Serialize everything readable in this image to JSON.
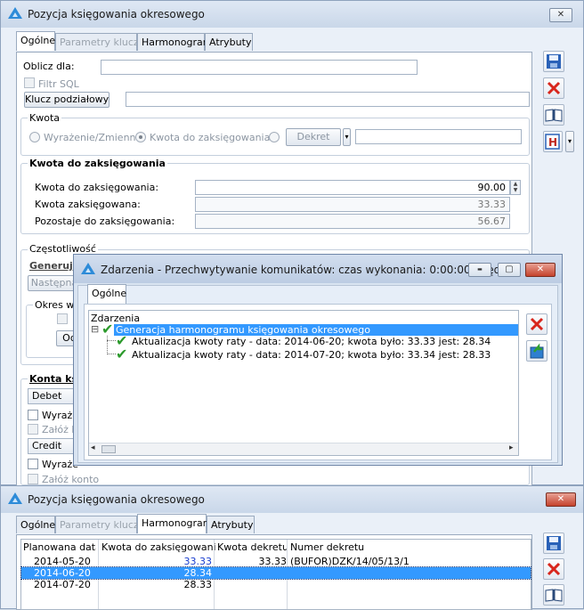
{
  "main_window": {
    "title": "Pozycja księgowania okresowego",
    "close_label": "✕",
    "tabs": [
      {
        "label": "Ogólne",
        "state": "active"
      },
      {
        "label": "Parametry klucza",
        "state": "disabled"
      },
      {
        "label": "Harmonogram",
        "state": "normal"
      },
      {
        "label": "Atrybuty",
        "state": "normal"
      }
    ],
    "oblicz_dla_label": "Oblicz dla:",
    "oblicz_dla_value": "",
    "filtr_sql_label": "Filtr SQL",
    "klucz_button": "Klucz podziałowy",
    "klucz_value": "",
    "kwota_group": {
      "title": "Kwota",
      "radio_wyrazenie": "Wyrażenie/Zmienna",
      "radio_kwota": "Kwota do zaksięgowania",
      "dekret_button": "Dekret",
      "dekret_dropdown": "▾",
      "dekret_value": ""
    },
    "kwota_zaks_group": {
      "title": "Kwota do zaksięgowania",
      "rows": [
        {
          "label": "Kwota do zaksięgowania:",
          "value": "90.00"
        },
        {
          "label": "Kwota zaksięgowana:",
          "value": "33.33"
        },
        {
          "label": "Pozostaje do zaksięgowania:",
          "value": "56.67"
        }
      ]
    },
    "czestotliwosc_group": {
      "title": "Częstotliwość",
      "generuj_label": "Generuj c",
      "nastepna_button": "Następna",
      "okres_label": "Okres wa",
      "od_button": "Od"
    },
    "konta_group": {
      "title": "Konta ksi",
      "debet_select": "Debet",
      "debet_wyraz": "Wyraże",
      "debet_zaloz": "Załóż ko",
      "credit_select": "Credit",
      "credit_wyraz": "Wyraże",
      "credit_zaloz": "Załóż konto"
    },
    "side_menu_arrow": "▾"
  },
  "dialog": {
    "title": "Zdarzenia - Przechwytywanie komunikatów: czas wykonania: 0:00:00, błędó...",
    "minimize": "▬",
    "maximize": "▢",
    "close": "✕",
    "tab": "Ogólne",
    "tree_header": "Zdarzenia",
    "root_label": "Generacja harmonogramu księgowania okresowego",
    "expander": "⊟",
    "children": [
      "Aktualizacja kwoty raty - data: 2014-06-20; kwota było: 33.33 jest: 28.34",
      "Aktualizacja kwoty raty - data: 2014-07-20; kwota było: 33.34 jest: 28.33"
    ],
    "scroll_left": "◂",
    "scroll_right": "▸"
  },
  "bottom_window": {
    "title": "Pozycja księgowania okresowego",
    "close_label": "✕",
    "tabs": [
      {
        "label": "Ogólne",
        "state": "normal"
      },
      {
        "label": "Parametry klucza",
        "state": "disabled"
      },
      {
        "label": "Harmonogram",
        "state": "active"
      },
      {
        "label": "Atrybuty",
        "state": "normal"
      }
    ],
    "columns": [
      "Planowana data k",
      "Kwota do zaksięgowania",
      "Kwota dekretu",
      "Numer dekretu"
    ],
    "rows": [
      {
        "date": "2014-05-20",
        "kwota": "33.33",
        "kwota_dekretu": "33.33",
        "numer": "(BUFOR)DZK/14/05/13/1",
        "selected": false
      },
      {
        "date": "2014-06-20",
        "kwota": "28.34",
        "kwota_dekretu": "",
        "numer": "",
        "selected": true
      },
      {
        "date": "2014-07-20",
        "kwota": "28.33",
        "kwota_dekretu": "",
        "numer": "",
        "selected": false
      }
    ]
  },
  "colors": {
    "accent_blue": "#2d8bd8",
    "selection": "#3399ff",
    "save_icon": "#2a62b8",
    "delete_icon": "#d8261c",
    "check_green": "#2c9a2c",
    "highlight_h": "#c0281e"
  }
}
